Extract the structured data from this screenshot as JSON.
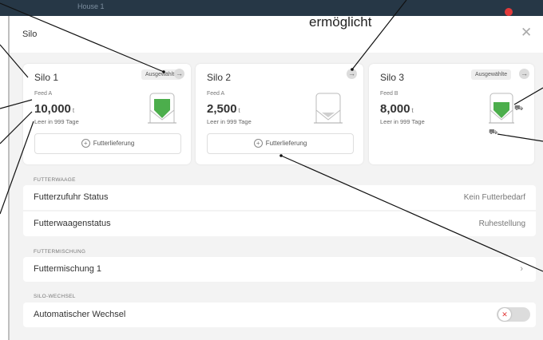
{
  "background": {
    "header_text": "House 1",
    "notification_count": "1"
  },
  "caption": "ermöglicht",
  "modal": {
    "title": "Silo",
    "close_icon": "close-icon"
  },
  "silos": [
    {
      "name": "Silo 1",
      "badge": "Ausgewählte",
      "feed": "Feed A",
      "amount": "10,000",
      "unit": "t",
      "empty_in": "Leer in 999 Tage",
      "button": "Futterlieferung",
      "fill_fraction": 0.7
    },
    {
      "name": "Silo 2",
      "badge": "",
      "feed": "Feed A",
      "amount": "2,500",
      "unit": "t",
      "empty_in": "Leer in 999 Tage",
      "button": "Futterlieferung",
      "fill_fraction": 0.0
    },
    {
      "name": "Silo 3",
      "badge": "Ausgewählte",
      "feed": "Feed B",
      "amount": "8,000",
      "unit": "t",
      "empty_in": "Leer in 999 Tage",
      "button": "",
      "fill_fraction": 0.6
    }
  ],
  "sections": {
    "futterwaage": {
      "title": "FUTTERWAAGE",
      "rows": [
        {
          "label": "Futterzufuhr Status",
          "value": "Kein Futterbedarf"
        },
        {
          "label": "Futterwaagenstatus",
          "value": "Ruhestellung"
        }
      ]
    },
    "futtermischung": {
      "title": "FUTTERMISCHUNG",
      "row_label": "Futtermischung 1"
    },
    "silo_wechsel": {
      "title": "SILO-WECHSEL",
      "row_label": "Automatischer Wechsel",
      "toggle_on": false
    }
  },
  "colors": {
    "accent_green": "#4cae4c",
    "header_dark": "#263746",
    "toggle_off_red": "#e23a3a"
  }
}
